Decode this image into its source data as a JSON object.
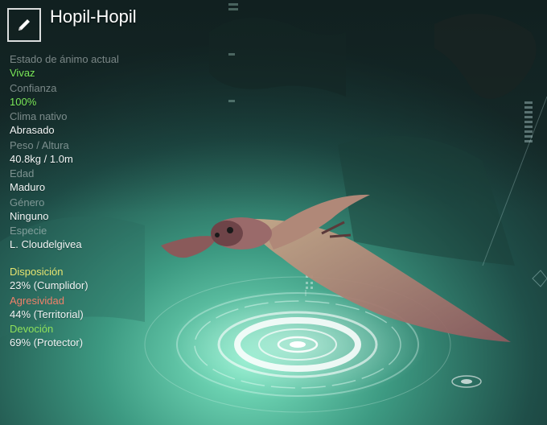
{
  "creature": {
    "name": "Hopil-Hopil"
  },
  "colors": {
    "accent_green": "#7be95a",
    "disposition": "#e6e470",
    "aggression": "#f0806a",
    "devotion": "#8fe05a"
  },
  "stats": [
    {
      "label": "Estado de ánimo actual",
      "value": "Vivaz",
      "highlight": true
    },
    {
      "label": "Confianza",
      "value": "100%",
      "highlight": true
    },
    {
      "label": "Clima nativo",
      "value": "Abrasado"
    },
    {
      "label": "Peso / Altura",
      "value": "40.8kg / 1.0m"
    },
    {
      "label": "Edad",
      "value": "Maduro"
    },
    {
      "label": "Género",
      "value": "Ninguno"
    },
    {
      "label": "Especie",
      "value": "L. Cloudelgivea"
    }
  ],
  "traits": [
    {
      "label": "Disposición",
      "value": "23% (Cumplidor)",
      "percent": 23
    },
    {
      "label": "Agresividad",
      "value": "44% (Territorial)",
      "percent": 44
    },
    {
      "label": "Devoción",
      "value": "69% (Protector)",
      "percent": 69
    }
  ],
  "icons": {
    "edit": "pencil-icon"
  }
}
